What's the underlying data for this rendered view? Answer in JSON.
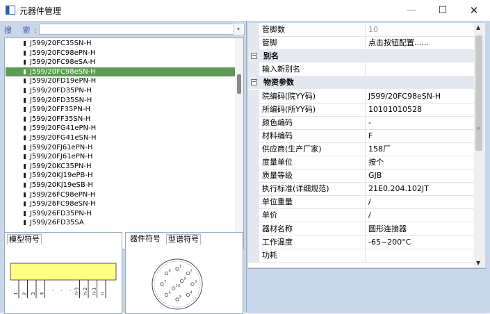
{
  "window": {
    "title": "元器件管理",
    "minimize": "—",
    "maximize": "☐",
    "close": "✕"
  },
  "search": {
    "label": "搜 索:",
    "value": "",
    "dropdown": "▾"
  },
  "tree": {
    "items": [
      "J599/20FC35SN-H",
      "J599/20FC98ePN-H",
      "J599/20FC98eSA-H",
      "J599/20FC98eSN-H",
      "J599/20FD19ePN-H",
      "J599/20FD35PN-H",
      "J599/20FD35SN-H",
      "J599/20FF35PN-H",
      "J599/20FF35SN-H",
      "J599/20FG41ePN-H",
      "J599/20FG41eSN-H",
      "J599/20FJ61ePN-H",
      "J599/20FJ61ePN-H",
      "J599/20KC35PN-H",
      "J599/20KJ19ePB-H",
      "J599/20KJ19eSB-H",
      "J599/26FC98ePN-H",
      "J599/26FC98eSN-H",
      "J599/26FD35PN-H",
      "J599/26FD35SA"
    ],
    "selected_index": 3
  },
  "symbols": {
    "model_tab": "模型符号",
    "device_tab": "器件符号",
    "spectrum_tab": "型谱符号",
    "pin_labels": [
      "1",
      "2",
      "3",
      "4",
      "·",
      "·",
      "·",
      "n-3",
      "n-2",
      "n-1",
      "n"
    ],
    "circle_pins": [
      "1",
      "2",
      "3",
      "4",
      "5",
      "6",
      "7",
      "8",
      "9",
      "10"
    ],
    "yellow": "#ffff80"
  },
  "props": {
    "rows": [
      {
        "kind": "prop",
        "name": "管脚数",
        "value": "10",
        "dim": true
      },
      {
        "kind": "prop",
        "name": "管脚",
        "value": "点击按钮配置......"
      },
      {
        "kind": "cat",
        "name": "别名",
        "toggle": "−"
      },
      {
        "kind": "prop",
        "name": "输入新别名",
        "value": ""
      },
      {
        "kind": "cat",
        "name": "物资参数",
        "toggle": "−"
      },
      {
        "kind": "prop",
        "name": "院编码(院YY码)",
        "value": "J599/20FC98eSN-H"
      },
      {
        "kind": "prop",
        "name": "所编码(所YY码)",
        "value": "10101010528"
      },
      {
        "kind": "prop",
        "name": "颜色编码",
        "value": "-"
      },
      {
        "kind": "prop",
        "name": "材料编码",
        "value": "F"
      },
      {
        "kind": "prop",
        "name": "供应商(生产厂家)",
        "value": "158厂"
      },
      {
        "kind": "prop",
        "name": "度量单位",
        "value": "按个"
      },
      {
        "kind": "prop",
        "name": "质量等级",
        "value": "GJB"
      },
      {
        "kind": "prop",
        "name": "执行标准(详细规范)",
        "value": "21E0.204.102JT"
      },
      {
        "kind": "prop",
        "name": "单位重量",
        "value": "/"
      },
      {
        "kind": "prop",
        "name": "单价",
        "value": "/"
      },
      {
        "kind": "prop",
        "name": "器材名称",
        "value": "圆形连接器"
      },
      {
        "kind": "prop",
        "name": "工作温度",
        "value": "-65~200°C"
      },
      {
        "kind": "prop",
        "name": "功耗",
        "value": ""
      }
    ],
    "scroll_up": "▲",
    "scroll_down": "▼",
    "scroll_grip": "≡"
  },
  "colors": {
    "selected": "#5c9c52",
    "panel": "#c9d7ea",
    "category": "#e4e8f0"
  }
}
